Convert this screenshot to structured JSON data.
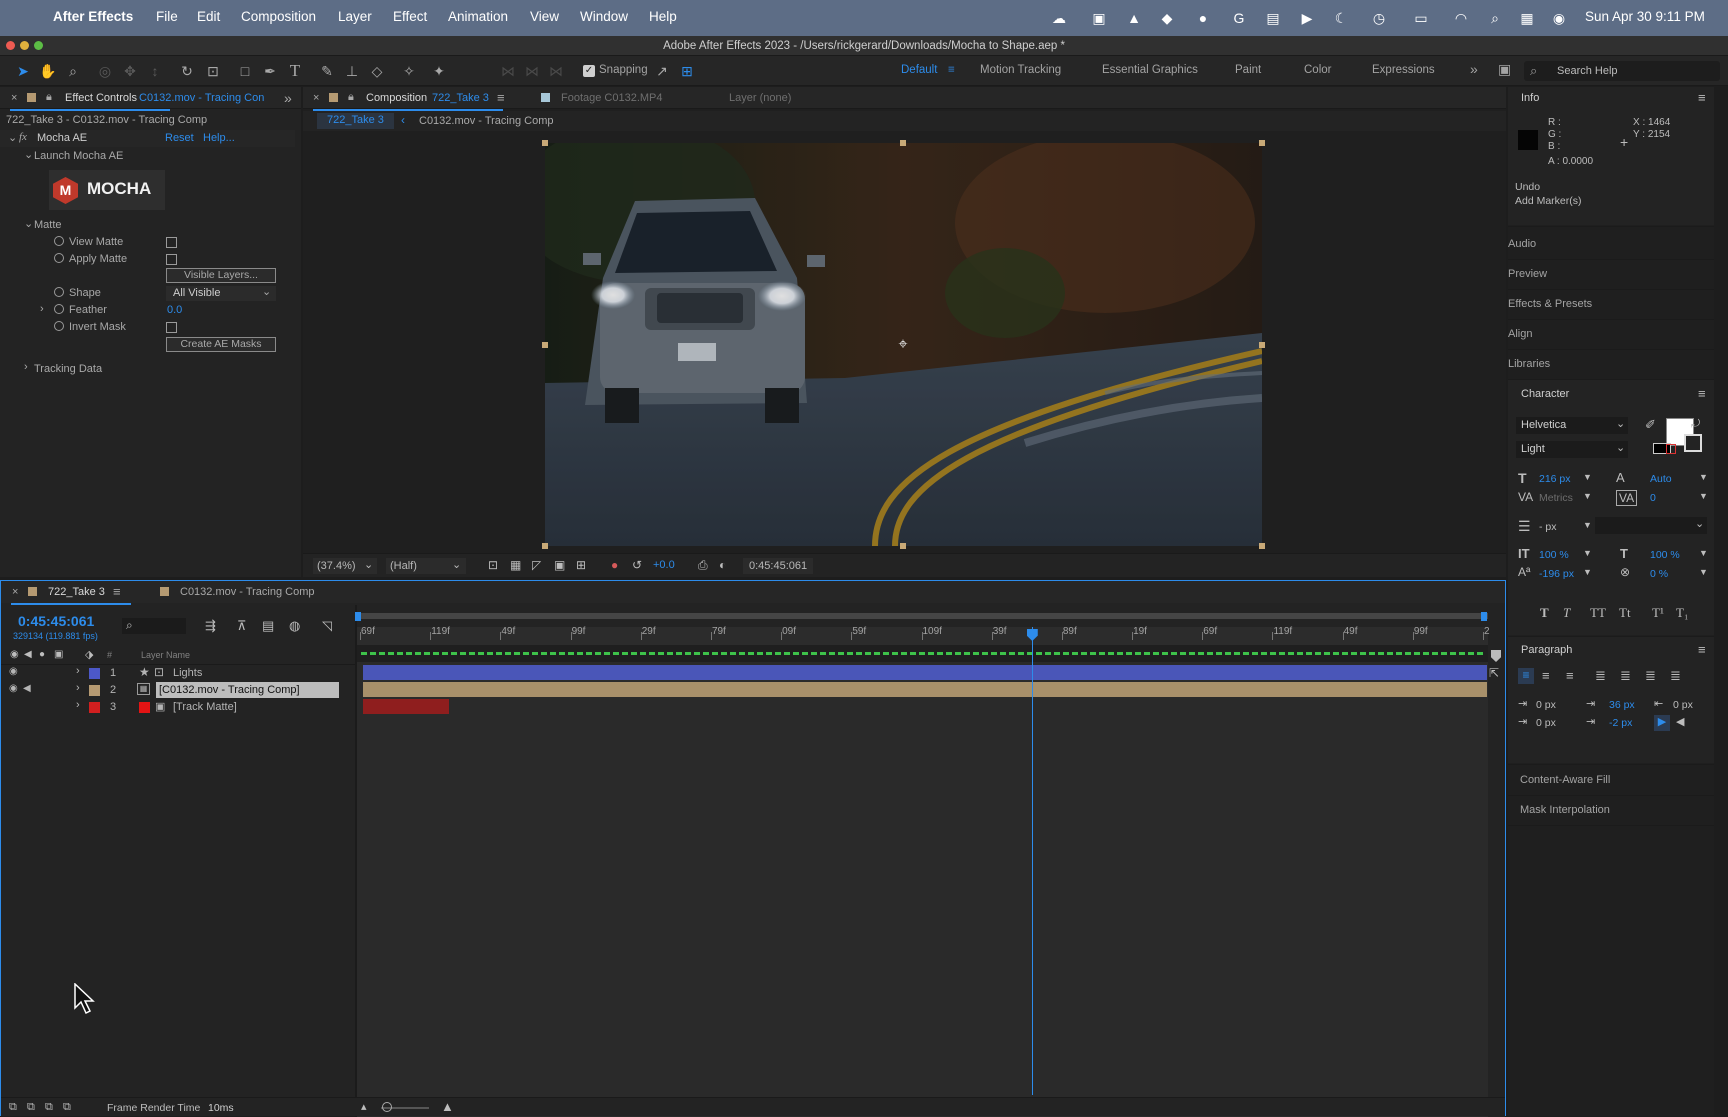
{
  "menubar": {
    "app": "After Effects",
    "items": [
      "File",
      "Edit",
      "Composition",
      "Layer",
      "Effect",
      "Animation",
      "View",
      "Window",
      "Help"
    ],
    "datetime": "Sun Apr 30  9:11 PM"
  },
  "window": {
    "title": "Adobe After Effects 2023 - /Users/rickgerard/Downloads/Mocha to Shape.aep *"
  },
  "toolbar": {
    "snapping": "Snapping",
    "workspaces": [
      "Default",
      "Motion Tracking",
      "Essential Graphics",
      "Paint",
      "Color",
      "Expressions"
    ],
    "search_placeholder": "Search Help"
  },
  "effect_controls": {
    "tab_prefix": "Effect Controls",
    "tab_target": "C0132.mov - Tracing Con",
    "breadcrumb": "722_Take 3 - C0132.mov - Tracing Comp",
    "fx_name": "Mocha AE",
    "reset": "Reset",
    "help": "Help...",
    "launch": "Launch Mocha AE",
    "logo_text": "MOCHA",
    "logo_letter": "M",
    "matte": "Matte",
    "view_matte": "View Matte",
    "apply_matte": "Apply Matte",
    "visible_layers": "Visible Layers...",
    "shape": "Shape",
    "shape_value": "All Visible",
    "feather": "Feather",
    "feather_value": "0.0",
    "invert_mask": "Invert Mask",
    "create_masks": "Create AE Masks",
    "tracking_data": "Tracking Data",
    "fx_label": "fx"
  },
  "viewer": {
    "tab_prefix": "Composition",
    "tab_comp": "722_Take 3",
    "footage_tab": "Footage C0132.MP4",
    "layer_tab": "Layer (none)",
    "crumb_active": "722_Take 3",
    "crumb_other": "C0132.mov - Tracing Comp",
    "zoom": "(37.4%)",
    "resolution": "(Half)",
    "exposure": "+0.0",
    "timecode": "0:45:45:061"
  },
  "timeline": {
    "tab_active": "722_Take 3",
    "tab_other": "C0132.mov - Tracing Comp",
    "timecode": "0:45:45:061",
    "frames": "329134 (119.881 fps)",
    "col_num": "#",
    "col_name": "Layer Name",
    "ticks": [
      "69f",
      "119f",
      "49f",
      "99f",
      "29f",
      "79f",
      "09f",
      "59f",
      "109f",
      "39f",
      "89f",
      "19f",
      "69f",
      "119f",
      "49f",
      "99f",
      "2"
    ],
    "playhead_fraction": 0.595,
    "layers": [
      {
        "num": "1",
        "name": "Lights",
        "color": "#4c58c8"
      },
      {
        "num": "2",
        "name": "[C0132.mov - Tracing Comp]",
        "color": "#b59a72"
      },
      {
        "num": "3",
        "name": "[Track Matte]",
        "color": "#d11f1f"
      }
    ],
    "render_time_label": "Frame Render Time",
    "render_time_value": "10ms"
  },
  "info": {
    "title": "Info",
    "r": "R :",
    "g": "G :",
    "b": "B :",
    "a": "A :  0.0000",
    "x": "X : 1464",
    "y": "Y : 2154",
    "undo": "Undo",
    "marker": "Add Marker(s)"
  },
  "right_panels": [
    "Audio",
    "Preview",
    "Effects & Presets",
    "Align",
    "Libraries"
  ],
  "character": {
    "title": "Character",
    "font": "Helvetica",
    "style": "Light",
    "size": "216 px",
    "leading": "Auto",
    "kerning": "Metrics",
    "tracking": "0",
    "stroke": "- px",
    "vscale": "100 %",
    "hscale": "100 %",
    "baseline": "-196 px",
    "tsume": "0 %",
    "styles": [
      "T",
      "T",
      "TT",
      "Tt",
      "T¹",
      "T₁"
    ]
  },
  "paragraph": {
    "title": "Paragraph",
    "indent_left": "0 px",
    "space_before": "36 px",
    "indent_right": "0 px",
    "first_line": "0 px",
    "space_after": "-2 px"
  },
  "bottom_panels": [
    "Content-Aware Fill",
    "Mask Interpolation"
  ],
  "colors": {
    "accent": "#2d8ceb",
    "panel": "#232323",
    "menubar": "#5d6d86"
  }
}
